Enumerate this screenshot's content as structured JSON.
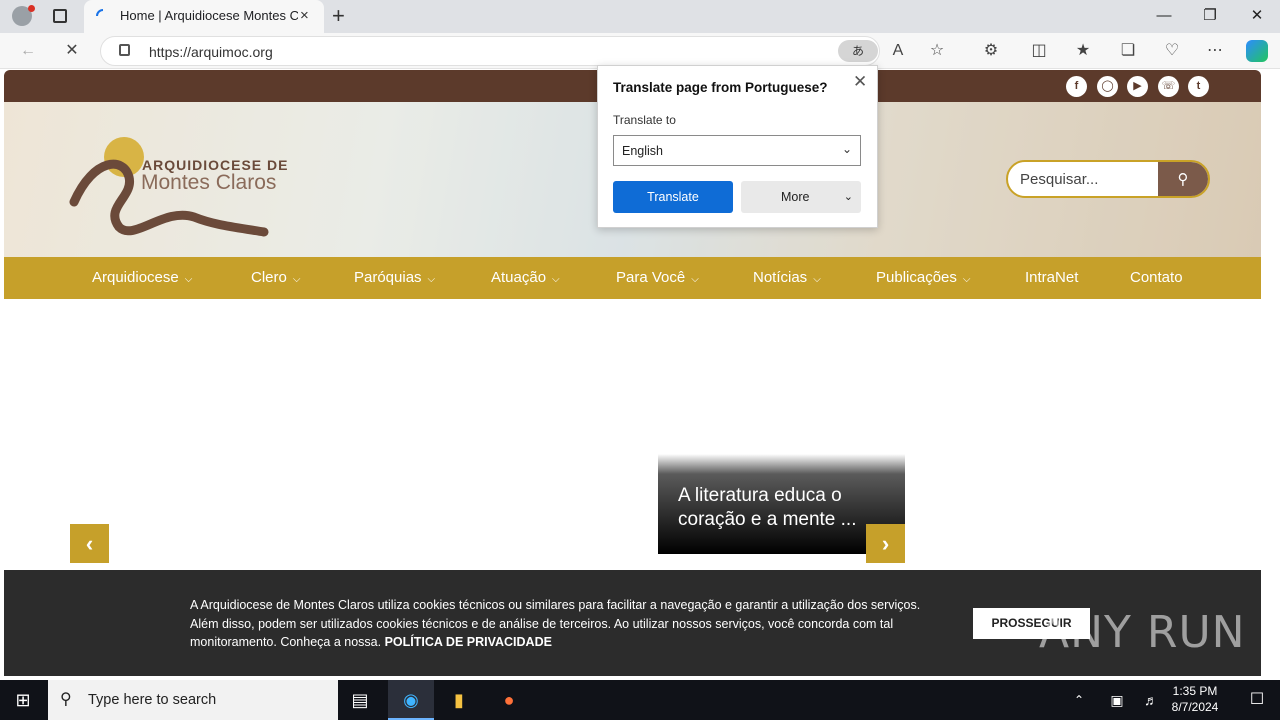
{
  "browser": {
    "tab_title": "Home | Arquidiocese Montes Cla",
    "url": "https://arquimoc.org",
    "new_tab": "+",
    "tab_close": "×"
  },
  "site": {
    "logo_line1": "ARQUIDIOCESE DE",
    "logo_line2": "Montes Claros",
    "search_placeholder": "Pesquisar...",
    "menu": [
      {
        "label": "Arquidiocese"
      },
      {
        "label": "Clero"
      },
      {
        "label": "Paróquias"
      },
      {
        "label": "Atuação"
      },
      {
        "label": "Para Você"
      },
      {
        "label": "Notícias"
      },
      {
        "label": "Publicações"
      },
      {
        "label": "IntraNet"
      },
      {
        "label": "Contato"
      }
    ],
    "slide_caption": "A literatura educa o coração e a mente ...",
    "cookie_text": "A Arquidiocese de Montes Claros utiliza cookies técnicos ou similares para facilitar a navegação e garantir a utilização dos serviços. Além disso, podem ser utilizados cookies técnicos e de análise de terceiros. Ao utilizar nossos serviços, você concorda com tal monitoramento. Conheça a nossa.",
    "cookie_link": "POLÍTICA DE PRIVACIDADE",
    "cookie_button": "PROSSEGUIR"
  },
  "translate_popup": {
    "heading": "Translate page from Portuguese?",
    "label": "Translate to",
    "selected_language": "English",
    "translate_button": "Translate",
    "more_button": "More"
  },
  "watermark": "ANY RUN",
  "taskbar": {
    "search_placeholder": "Type here to search",
    "time": "1:35 PM",
    "date": "8/7/2024"
  }
}
